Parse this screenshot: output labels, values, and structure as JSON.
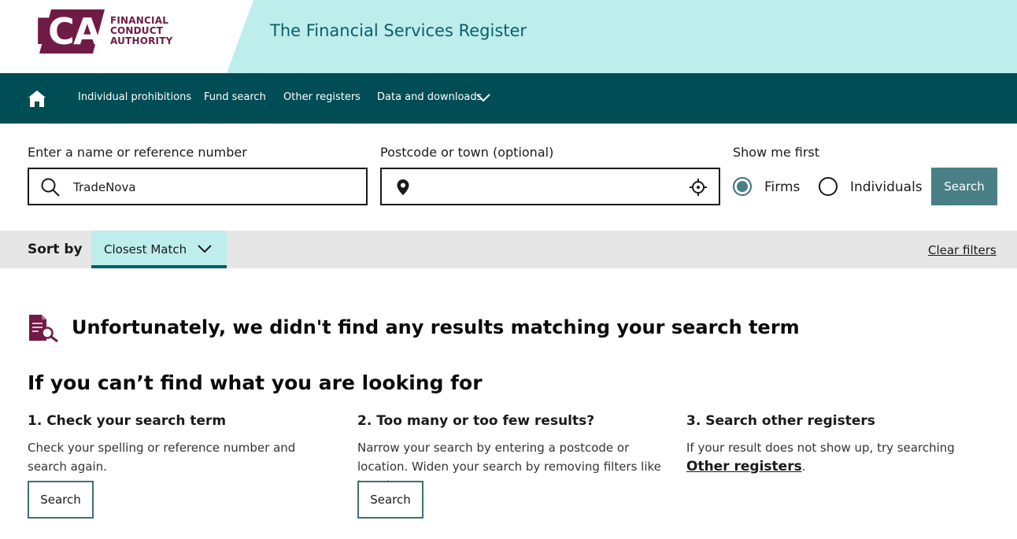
{
  "header": {
    "logo_letters": "FCA",
    "logo_text_lines": [
      "FINANCIAL",
      "CONDUCT",
      "AUTHORITY"
    ],
    "site_title": "The Financial Services Register"
  },
  "nav": {
    "home_icon": "home-icon",
    "items": [
      {
        "label": "Individual prohibitions"
      },
      {
        "label": "Fund search"
      },
      {
        "label": "Other registers"
      },
      {
        "label": "Data and downloads"
      }
    ]
  },
  "search": {
    "name_label": "Enter a name or reference number",
    "name_value": "TradeNova",
    "postcode_label": "Postcode or town (optional)",
    "postcode_value": "",
    "show_first_label": "Show me first",
    "options": [
      {
        "label": "Firms",
        "selected": true
      },
      {
        "label": "Individuals",
        "selected": false
      }
    ],
    "button_label": "Search"
  },
  "sort": {
    "label": "Sort by",
    "selected": "Closest Match",
    "clear_filters": "Clear filters"
  },
  "results": {
    "no_results_message": "Unfortunately, we didn't find any results matching your search term",
    "help_title": "If you can’t find what you are looking for",
    "columns": [
      {
        "heading": "1. Check your search term",
        "text": "Check your spelling or reference number and search again.",
        "button": "Search"
      },
      {
        "heading": "2. Too many or too few results?",
        "text": "Narrow your search by entering a postcode or location. Widen your search by removing filters like location.",
        "button": "Search"
      },
      {
        "heading": "3. Search other registers",
        "text_before": "If your result does not show up, try searching ",
        "link": "Other registers",
        "text_after": "."
      }
    ]
  },
  "colors": {
    "brand": "#701b45",
    "header_band": "#bdeeeb",
    "nav": "#004d56",
    "accent": "#4a7f86"
  }
}
